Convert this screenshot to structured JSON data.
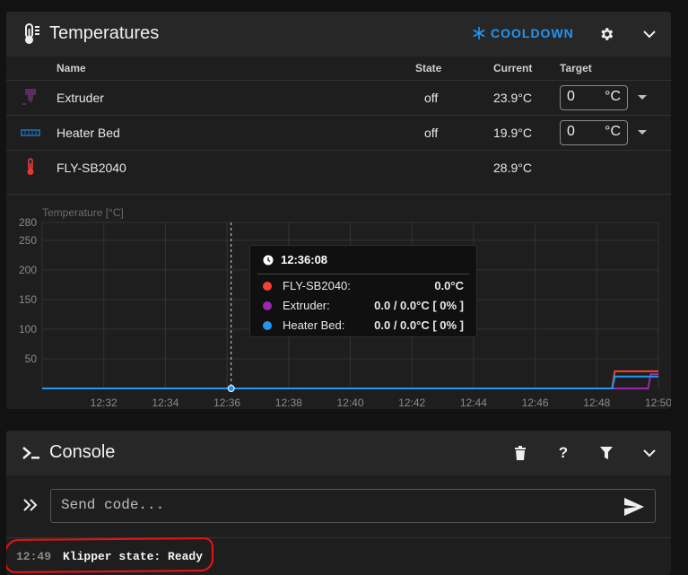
{
  "temperatures": {
    "title": "Temperatures",
    "cooldown_label": "COOLDOWN",
    "columns": {
      "name": "Name",
      "state": "State",
      "current": "Current",
      "target": "Target"
    },
    "rows": [
      {
        "name": "Extruder",
        "state": "off",
        "current": "23.9°C",
        "target": "0",
        "unit": "°C",
        "icon": "extruder-icon",
        "color": "#5a2d5e"
      },
      {
        "name": "Heater Bed",
        "state": "off",
        "current": "19.9°C",
        "target": "0",
        "unit": "°C",
        "icon": "heater-bed-icon",
        "color": "#1e6fb5"
      },
      {
        "name": "FLY-SB2040",
        "state": "",
        "current": "28.9°C",
        "icon": "thermometer-icon",
        "color": "#e53935"
      }
    ]
  },
  "chart_data": {
    "type": "line",
    "ylabel": "Temperature [°C]",
    "ylim": [
      0,
      280
    ],
    "yticks": [
      50,
      100,
      150,
      200,
      250,
      280
    ],
    "xticks": [
      "12:32",
      "12:34",
      "12:36",
      "12:38",
      "12:40",
      "12:42",
      "12:44",
      "12:46",
      "12:48",
      "12:50"
    ],
    "grid": true,
    "series": [
      {
        "name": "FLY-SB2040",
        "color": "#f44336",
        "points": [
          [
            "12:30",
            0
          ],
          [
            "12:48:30",
            0
          ],
          [
            "12:48:35",
            29
          ],
          [
            "12:50",
            29
          ]
        ]
      },
      {
        "name": "Extruder",
        "color": "#9c27b0",
        "points": [
          [
            "12:30",
            0
          ],
          [
            "12:49:40",
            0
          ],
          [
            "12:49:45",
            24
          ],
          [
            "12:50",
            24
          ]
        ]
      },
      {
        "name": "Heater Bed",
        "color": "#2196f3",
        "points": [
          [
            "12:30",
            0
          ],
          [
            "12:48:30",
            0
          ],
          [
            "12:48:35",
            20
          ],
          [
            "12:50",
            20
          ]
        ]
      }
    ],
    "tooltip": {
      "time": "12:36:08",
      "rows": [
        {
          "label": "FLY-SB2040:",
          "value": "0.0°C",
          "color": "#f44336"
        },
        {
          "label": "Extruder:",
          "value": "0.0 / 0.0°C [ 0% ]",
          "color": "#9c27b0"
        },
        {
          "label": "Heater Bed:",
          "value": "0.0 / 0.0°C [ 0% ]",
          "color": "#2196f3"
        }
      ]
    }
  },
  "console": {
    "title": "Console",
    "input_placeholder": "Send code...",
    "log": [
      {
        "time": "12:49",
        "message": "Klipper state: Ready"
      }
    ]
  },
  "colors": {
    "accent": "#2196f3",
    "annotation": "#e11111"
  }
}
